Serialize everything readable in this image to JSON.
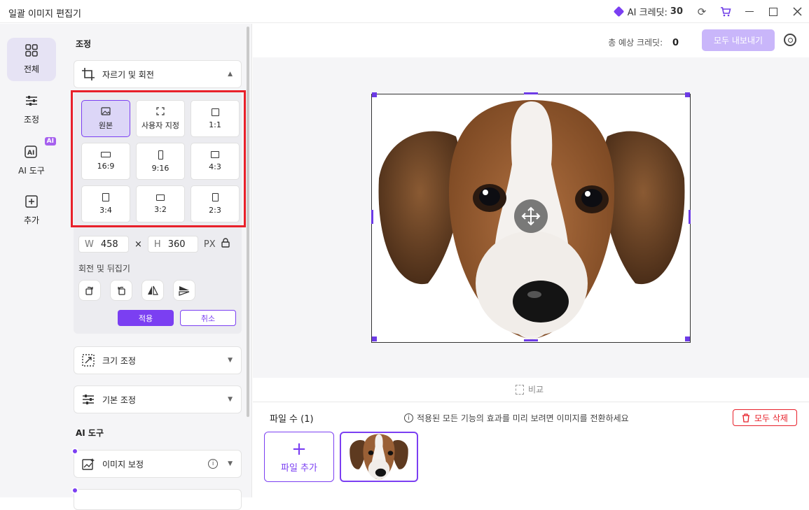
{
  "app": {
    "title": "일괄 이미지 편집기"
  },
  "titlebar": {
    "credit_label": "AI 크레딧:",
    "credit_value": "30"
  },
  "sidenav": {
    "items": [
      {
        "label": "전체",
        "icon": "grid-icon"
      },
      {
        "label": "조정",
        "icon": "sliders-icon"
      },
      {
        "label": "AI 도구",
        "icon": "ai-tool-icon",
        "badge": "AI"
      },
      {
        "label": "추가",
        "icon": "plus-box-icon"
      }
    ]
  },
  "panel": {
    "section_adjust": "조정",
    "crop": {
      "label": "자르기 및 회전"
    },
    "ratios": [
      {
        "label": "원본",
        "selected": true
      },
      {
        "label": "사용자 지정"
      },
      {
        "label": "1:1"
      },
      {
        "label": "16:9"
      },
      {
        "label": "9:16"
      },
      {
        "label": "4:3"
      },
      {
        "label": "3:4"
      },
      {
        "label": "3:2"
      },
      {
        "label": "2:3"
      }
    ],
    "dims": {
      "w_label": "W",
      "w_value": "458",
      "times": "×",
      "h_label": "H",
      "h_value": "360",
      "unit": "PX"
    },
    "rotate_label": "회전 및 뒤집기",
    "apply": "적용",
    "cancel": "취소",
    "resize": {
      "label": "크기 조정"
    },
    "basic": {
      "label": "기본 조정"
    },
    "section_ai": "AI 도구",
    "enhance": {
      "label": "이미지 보정"
    }
  },
  "main": {
    "total_credit_label": "총 예상 크레딧:",
    "total_credit_value": "0",
    "export_label": "모두 내보내기",
    "compare_label": "비교",
    "file_count": "파일 수 (1)",
    "hint": "적용된 모든 기능의 효과를 미리 보려면 이미지를 전환하세요",
    "delete_all": "모두 삭제",
    "add_file": "파일 추가"
  },
  "colors": {
    "accent": "#7b3ff2",
    "highlight": "#e8202a"
  }
}
